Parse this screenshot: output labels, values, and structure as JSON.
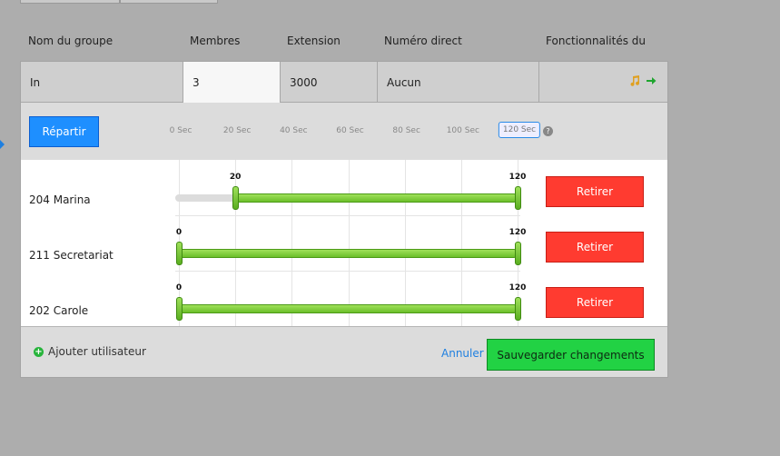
{
  "columns": {
    "group_name": "Nom du groupe",
    "members": "Membres",
    "extension": "Extension",
    "direct_number": "Numéro direct",
    "features": "Fonctionnalités du"
  },
  "group": {
    "name": "In",
    "members": "3",
    "extension": "3000",
    "direct_number": "Aucun"
  },
  "toolbar": {
    "distribute_label": "Répartir",
    "ticks": [
      "0 Sec",
      "20 Sec",
      "40 Sec",
      "60 Sec",
      "80 Sec",
      "100 Sec",
      "120 Sec"
    ],
    "help_label": "?"
  },
  "users": [
    {
      "name": "204 Marina",
      "start": 20,
      "end": 120,
      "start_label": "20",
      "end_label": "120",
      "remove_label": "Retirer"
    },
    {
      "name": "211 Secretariat",
      "start": 0,
      "end": 120,
      "start_label": "0",
      "end_label": "120",
      "remove_label": "Retirer"
    },
    {
      "name": "202 Carole",
      "start": 0,
      "end": 120,
      "start_label": "0",
      "end_label": "120",
      "remove_label": "Retirer"
    }
  ],
  "scale_max": 120,
  "footer": {
    "add_user_label": "Ajouter utilisateur",
    "cancel_label": "Annuler",
    "save_label": "Sauvegarder changements"
  },
  "colors": {
    "primary": "#1e8fff",
    "danger": "#ff3b30",
    "success": "#22d244",
    "bar": "#7dcc36"
  },
  "icons": {
    "music": "music-note-icon",
    "arrow": "arrow-right-icon",
    "add": "plus-circle-icon",
    "help": "question-circle-icon"
  }
}
